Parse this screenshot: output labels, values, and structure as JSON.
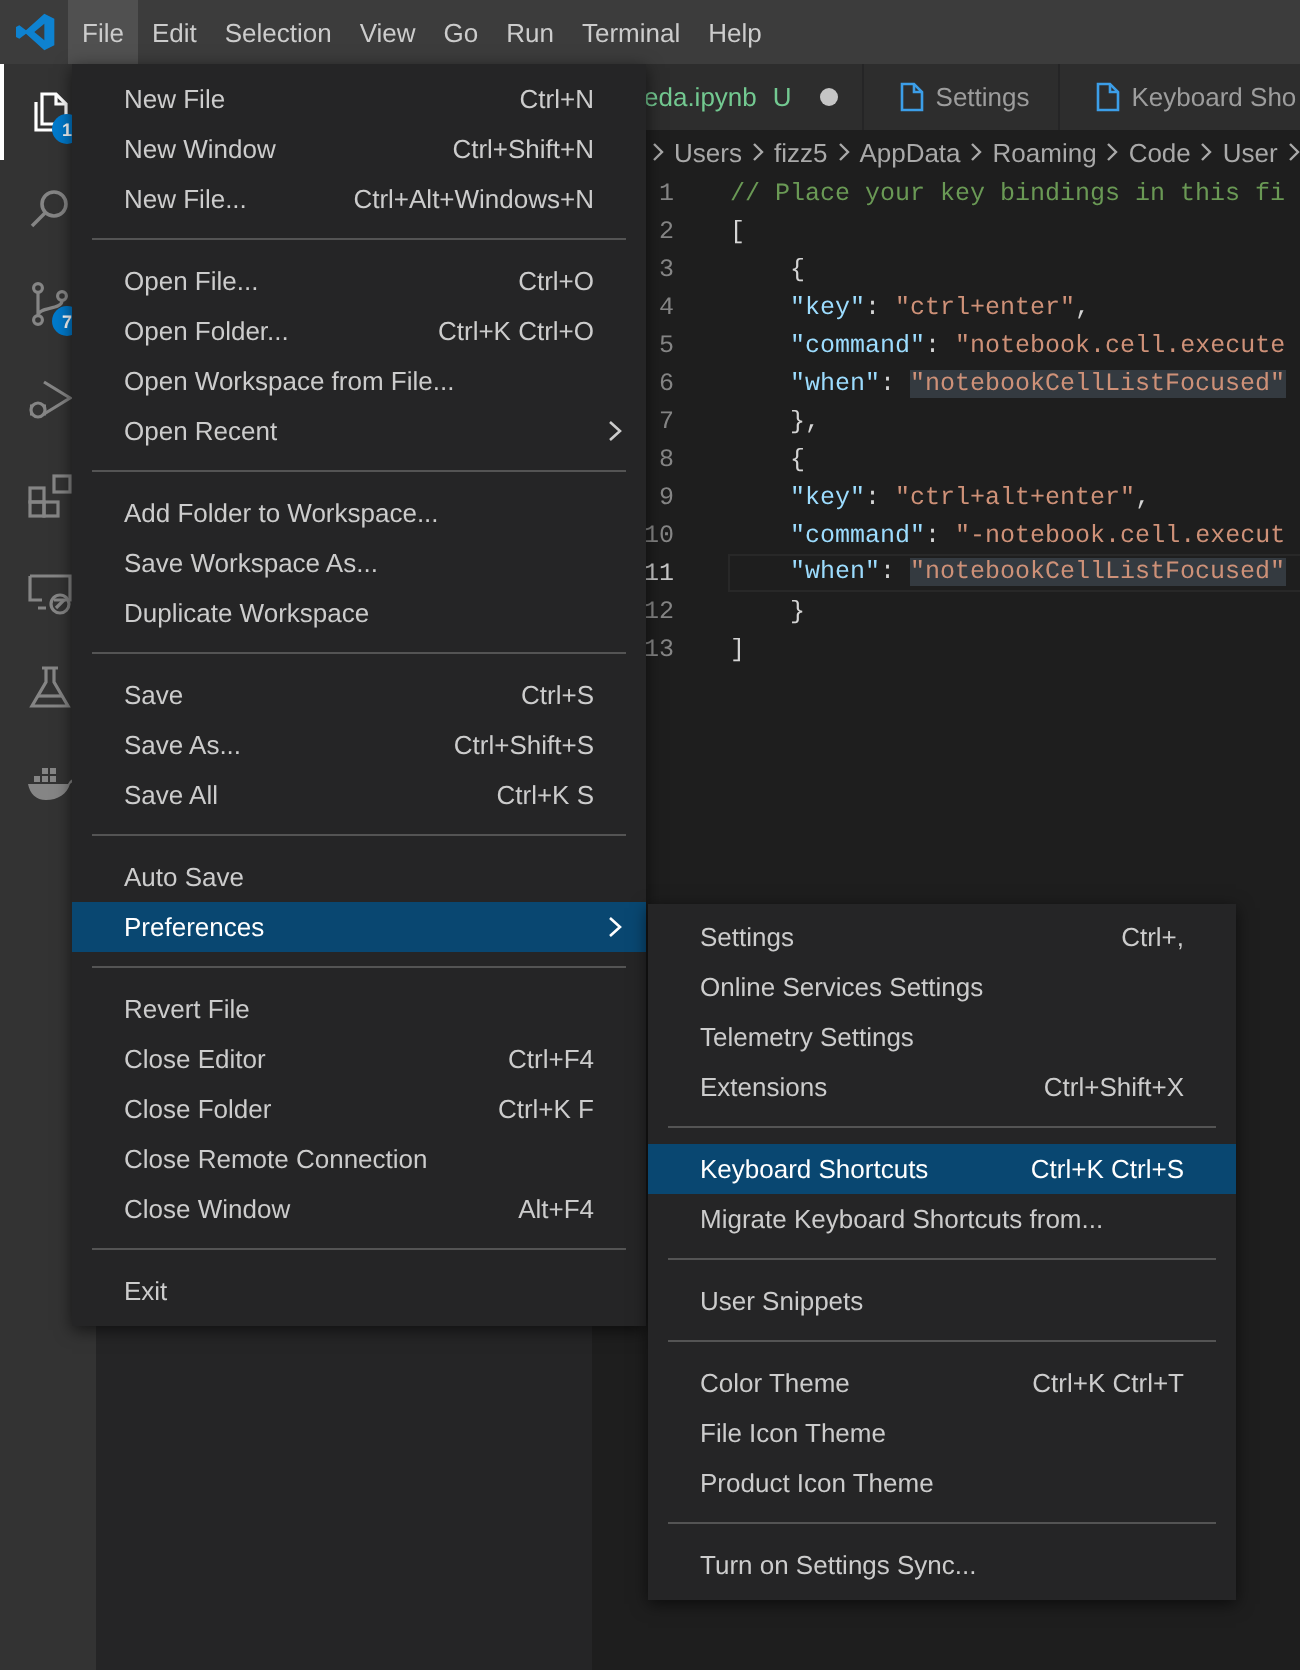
{
  "menubar": [
    {
      "label": "File",
      "selected": true
    },
    {
      "label": "Edit",
      "selected": false
    },
    {
      "label": "Selection",
      "selected": false
    },
    {
      "label": "View",
      "selected": false
    },
    {
      "label": "Go",
      "selected": false
    },
    {
      "label": "Run",
      "selected": false
    },
    {
      "label": "Terminal",
      "selected": false
    },
    {
      "label": "Help",
      "selected": false
    }
  ],
  "activity_bar": [
    {
      "kind": "files",
      "badge": "1",
      "selected": true
    },
    {
      "kind": "search",
      "selected": false
    },
    {
      "kind": "source-control",
      "badge": "7",
      "selected": false
    },
    {
      "kind": "run-debug",
      "selected": false
    },
    {
      "kind": "extensions",
      "selected": false
    },
    {
      "kind": "remote",
      "selected": false
    },
    {
      "kind": "testing",
      "selected": false
    },
    {
      "kind": "docker",
      "selected": false
    }
  ],
  "tabs": [
    {
      "label": "eda.ipynb",
      "decoration": "U",
      "dirty": true,
      "icon": false
    },
    {
      "label": "Settings",
      "dirty": false,
      "icon": true
    },
    {
      "label": "Keyboard Sho",
      "dirty": false,
      "icon": true
    }
  ],
  "breadcrumbs": [
    "Users",
    "fizz5",
    "AppData",
    "Roaming",
    "Code",
    "User"
  ],
  "editor": {
    "lines": [
      {
        "number": "1",
        "current": false,
        "tokens": [
          {
            "kind": "comment",
            "text": "// Place your key bindings in this fi"
          }
        ]
      },
      {
        "number": "2",
        "current": false,
        "tokens": [
          {
            "kind": "punct",
            "text": "["
          }
        ]
      },
      {
        "number": "3",
        "current": false,
        "tokens": [
          {
            "kind": "punct",
            "text": "    {"
          }
        ]
      },
      {
        "number": "4",
        "current": false,
        "tokens": [
          {
            "kind": "key",
            "text": "    \"key\""
          },
          {
            "kind": "punct",
            "text": ": "
          },
          {
            "kind": "string",
            "text": "\"ctrl+enter\""
          },
          {
            "kind": "punct",
            "text": ","
          }
        ]
      },
      {
        "number": "5",
        "current": false,
        "tokens": [
          {
            "kind": "key",
            "text": "    \"command\""
          },
          {
            "kind": "punct",
            "text": ": "
          },
          {
            "kind": "string",
            "text": "\"notebook.cell.execute"
          }
        ]
      },
      {
        "number": "6",
        "current": false,
        "tokens": [
          {
            "kind": "key",
            "text": "    \"when\""
          },
          {
            "kind": "punct",
            "text": ": "
          },
          {
            "kind": "string-match",
            "text": "\"notebookCellListFocused\""
          }
        ]
      },
      {
        "number": "7",
        "current": false,
        "tokens": [
          {
            "kind": "punct",
            "text": "    },"
          }
        ]
      },
      {
        "number": "8",
        "current": false,
        "tokens": [
          {
            "kind": "punct",
            "text": "    {"
          }
        ]
      },
      {
        "number": "9",
        "current": false,
        "tokens": [
          {
            "kind": "key",
            "text": "    \"key\""
          },
          {
            "kind": "punct",
            "text": ": "
          },
          {
            "kind": "string",
            "text": "\"ctrl+alt+enter\""
          },
          {
            "kind": "punct",
            "text": ","
          }
        ]
      },
      {
        "number": "10",
        "current": false,
        "tokens": [
          {
            "kind": "key",
            "text": "    \"command\""
          },
          {
            "kind": "punct",
            "text": ": "
          },
          {
            "kind": "string",
            "text": "\"-notebook.cell.execut"
          }
        ]
      },
      {
        "number": "11",
        "current": true,
        "tokens": [
          {
            "kind": "key",
            "text": "    \"when\""
          },
          {
            "kind": "punct",
            "text": ": "
          },
          {
            "kind": "string-match",
            "text": "\"notebookCellListFocused\""
          }
        ]
      },
      {
        "number": "12",
        "current": false,
        "tokens": [
          {
            "kind": "punct",
            "text": "    }"
          }
        ]
      },
      {
        "number": "13",
        "current": false,
        "tokens": [
          {
            "kind": "punct",
            "text": "]"
          }
        ]
      }
    ]
  },
  "file_menu": {
    "items": [
      {
        "kind": "item",
        "label": "New File",
        "shortcut": "Ctrl+N",
        "selected": false
      },
      {
        "kind": "item",
        "label": "New Window",
        "shortcut": "Ctrl+Shift+N",
        "selected": false
      },
      {
        "kind": "item",
        "label": "New File...",
        "shortcut": "Ctrl+Alt+Windows+N",
        "selected": false
      },
      {
        "kind": "separator"
      },
      {
        "kind": "item",
        "label": "Open File...",
        "shortcut": "Ctrl+O",
        "selected": false
      },
      {
        "kind": "item",
        "label": "Open Folder...",
        "shortcut": "Ctrl+K Ctrl+O",
        "selected": false
      },
      {
        "kind": "item",
        "label": "Open Workspace from File...",
        "selected": false
      },
      {
        "kind": "item",
        "label": "Open Recent",
        "submenu": true,
        "selected": false
      },
      {
        "kind": "separator"
      },
      {
        "kind": "item",
        "label": "Add Folder to Workspace...",
        "selected": false
      },
      {
        "kind": "item",
        "label": "Save Workspace As...",
        "selected": false
      },
      {
        "kind": "item",
        "label": "Duplicate Workspace",
        "selected": false
      },
      {
        "kind": "separator"
      },
      {
        "kind": "item",
        "label": "Save",
        "shortcut": "Ctrl+S",
        "selected": false
      },
      {
        "kind": "item",
        "label": "Save As...",
        "shortcut": "Ctrl+Shift+S",
        "selected": false
      },
      {
        "kind": "item",
        "label": "Save All",
        "shortcut": "Ctrl+K S",
        "selected": false
      },
      {
        "kind": "separator"
      },
      {
        "kind": "item",
        "label": "Auto Save",
        "selected": false
      },
      {
        "kind": "item",
        "label": "Preferences",
        "submenu": true,
        "selected": true
      },
      {
        "kind": "separator"
      },
      {
        "kind": "item",
        "label": "Revert File",
        "selected": false
      },
      {
        "kind": "item",
        "label": "Close Editor",
        "shortcut": "Ctrl+F4",
        "selected": false
      },
      {
        "kind": "item",
        "label": "Close Folder",
        "shortcut": "Ctrl+K F",
        "selected": false
      },
      {
        "kind": "item",
        "label": "Close Remote Connection",
        "selected": false
      },
      {
        "kind": "item",
        "label": "Close Window",
        "shortcut": "Alt+F4",
        "selected": false
      },
      {
        "kind": "separator"
      },
      {
        "kind": "item",
        "label": "Exit",
        "selected": false
      }
    ]
  },
  "preferences_submenu": {
    "items": [
      {
        "kind": "item",
        "label": "Settings",
        "shortcut": "Ctrl+,",
        "selected": false
      },
      {
        "kind": "item",
        "label": "Online Services Settings",
        "selected": false
      },
      {
        "kind": "item",
        "label": "Telemetry Settings",
        "selected": false
      },
      {
        "kind": "item",
        "label": "Extensions",
        "shortcut": "Ctrl+Shift+X",
        "selected": false
      },
      {
        "kind": "separator"
      },
      {
        "kind": "item",
        "label": "Keyboard Shortcuts",
        "shortcut": "Ctrl+K Ctrl+S",
        "selected": true
      },
      {
        "kind": "item",
        "label": "Migrate Keyboard Shortcuts from...",
        "selected": false
      },
      {
        "kind": "separator"
      },
      {
        "kind": "item",
        "label": "User Snippets",
        "selected": false
      },
      {
        "kind": "separator"
      },
      {
        "kind": "item",
        "label": "Color Theme",
        "shortcut": "Ctrl+K Ctrl+T",
        "selected": false
      },
      {
        "kind": "item",
        "label": "File Icon Theme",
        "selected": false
      },
      {
        "kind": "item",
        "label": "Product Icon Theme",
        "selected": false
      },
      {
        "kind": "separator"
      },
      {
        "kind": "item",
        "label": "Turn on Settings Sync...",
        "selected": false
      }
    ]
  }
}
